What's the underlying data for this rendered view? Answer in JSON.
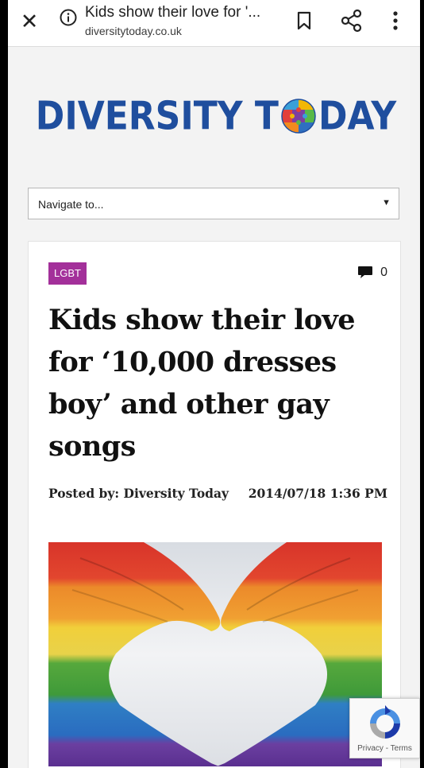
{
  "browser": {
    "tab_title": "Kids show their love for '...",
    "url": "diversitytoday.co.uk",
    "icons": [
      "close-icon",
      "info-icon",
      "bookmark-icon",
      "share-icon",
      "more-vert-icon"
    ]
  },
  "site": {
    "logo_part1": "DIVERSITY T",
    "logo_part2": "DAY",
    "brand_color": "#1f4e9e",
    "nav_select_value": "Navigate to..."
  },
  "article": {
    "category": "LGBT",
    "category_color": "#a3309a",
    "comment_count": "0",
    "title": "Kids show their love for ‘10,000 dresses boy’ and other gay songs",
    "posted_by": "Posted by: Diversity Today",
    "date": "2014/07/18 1:36 PM"
  },
  "recaptcha": {
    "links": "Privacy - Terms"
  }
}
